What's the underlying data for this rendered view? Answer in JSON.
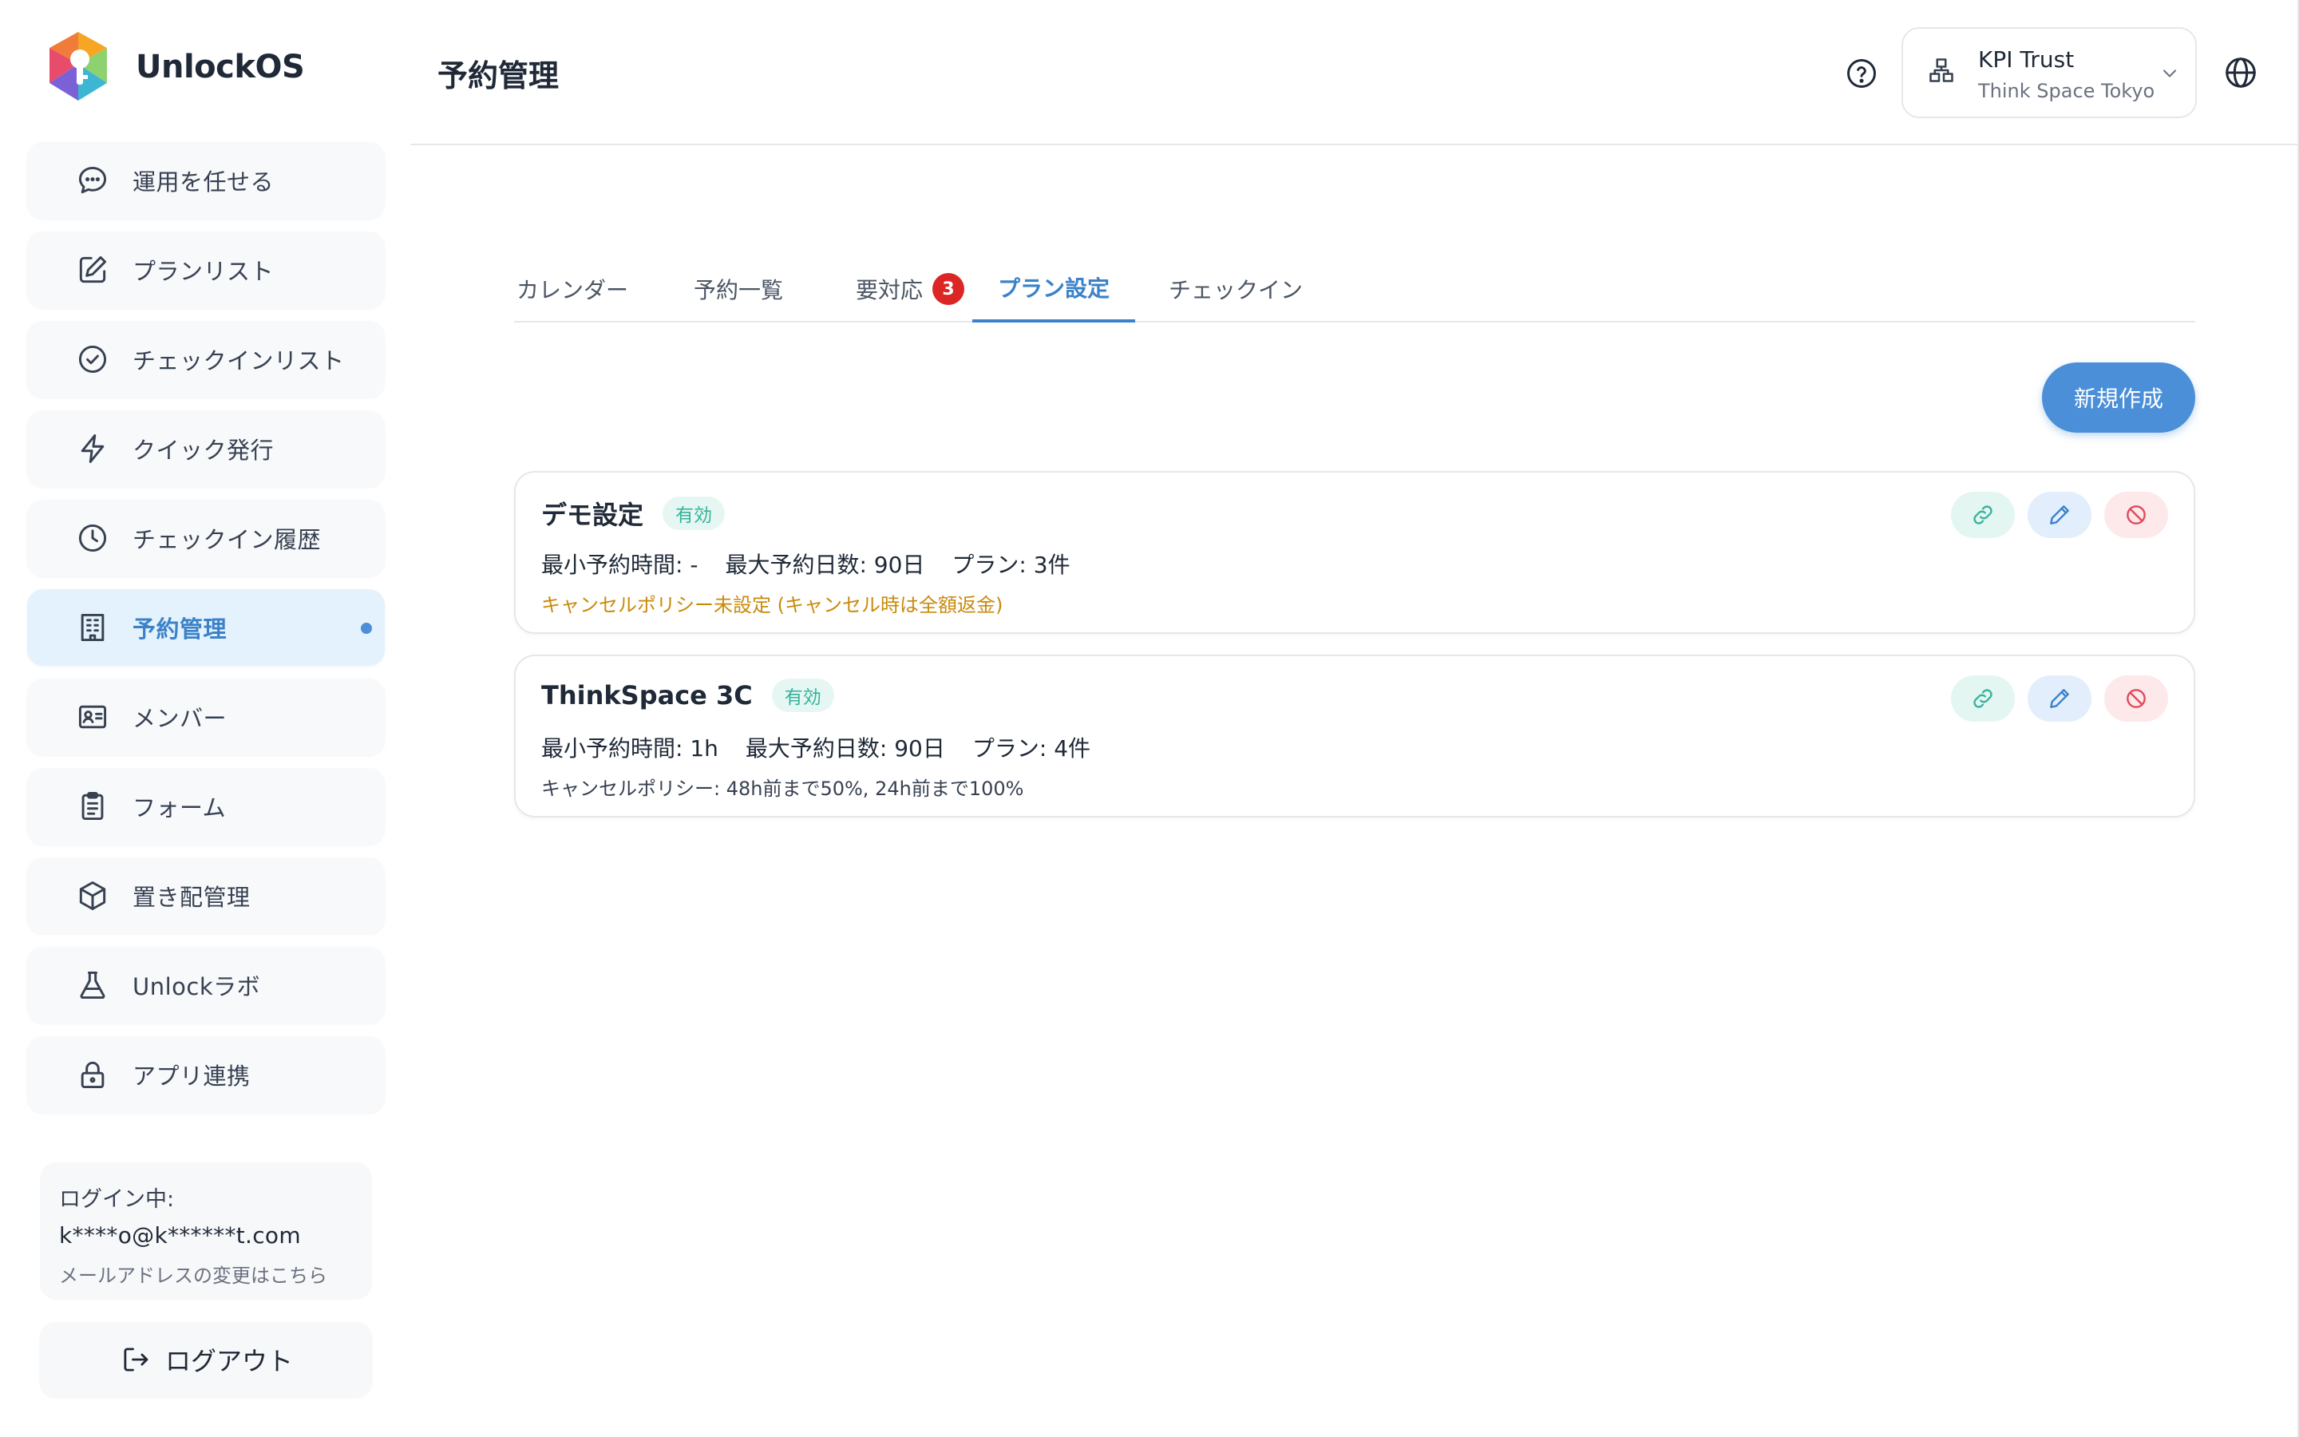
{
  "app": {
    "name": "UnlockOS",
    "colors": {
      "accent": "#4a8fd8",
      "active_bg": "#e4f2fd",
      "badge": "#dc2626",
      "status_green": "#34b39a",
      "warn": "#c98a0a"
    }
  },
  "sidebar": {
    "items": [
      {
        "label": "運用を任せる",
        "icon": "chat-bubble-icon",
        "active": false
      },
      {
        "label": "プランリスト",
        "icon": "edit-square-icon",
        "active": false
      },
      {
        "label": "チェックインリスト",
        "icon": "check-circle-icon",
        "active": false
      },
      {
        "label": "クイック発行",
        "icon": "lightning-icon",
        "active": false
      },
      {
        "label": "チェックイン履歴",
        "icon": "clock-icon",
        "active": false
      },
      {
        "label": "予約管理",
        "icon": "building-icon",
        "active": true
      },
      {
        "label": "メンバー",
        "icon": "id-card-icon",
        "active": false
      },
      {
        "label": "フォーム",
        "icon": "clipboard-icon",
        "active": false
      },
      {
        "label": "置き配管理",
        "icon": "package-icon",
        "active": false
      },
      {
        "label": "Unlockラボ",
        "icon": "flask-icon",
        "active": false
      },
      {
        "label": "アプリ連携",
        "icon": "lock-icon",
        "active": false
      }
    ],
    "login": {
      "label": "ログイン中:",
      "email": "k****o@k******t.com",
      "change_link": "メールアドレスの変更はこちら"
    },
    "logout_label": "ログアウト"
  },
  "header": {
    "title": "予約管理",
    "org": {
      "name": "KPI Trust",
      "location": "Think Space Tokyo"
    }
  },
  "tabs": [
    {
      "label": "カレンダー",
      "active": false
    },
    {
      "label": "予約一覧",
      "active": false
    },
    {
      "label": "要対応",
      "active": false,
      "badge": "3"
    },
    {
      "label": "プラン設定",
      "active": true
    },
    {
      "label": "チェックイン",
      "active": false
    }
  ],
  "create_button": "新規作成",
  "plans": [
    {
      "name": "デモ設定",
      "status": "有効",
      "min_time": "最小予約時間: -",
      "max_days": "最大予約日数: 90日",
      "plan_count": "プラン: 3件",
      "policy": "キャンセルポリシー未設定 (キャンセル時は全額返金)"
    },
    {
      "name": "ThinkSpace 3C",
      "status": "有効",
      "min_time": "最小予約時間: 1h",
      "max_days": "最大予約日数: 90日",
      "plan_count": "プラン: 4件",
      "policy": "キャンセルポリシー:  48h前まで50%,  24h前まで100%"
    }
  ]
}
